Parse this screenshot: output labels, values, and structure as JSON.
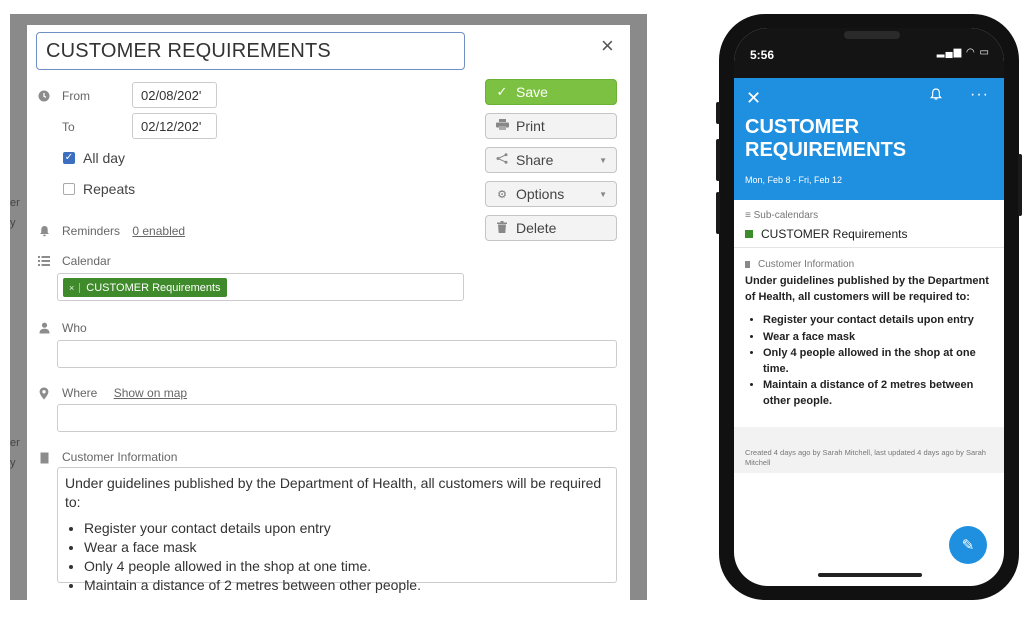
{
  "desktop": {
    "title": "CUSTOMER REQUIREMENTS",
    "close_glyph": "×",
    "from_label": "From",
    "from_value": "02/08/202'",
    "to_label": "To",
    "to_value": "02/12/202'",
    "all_day_label": "All day",
    "all_day_checked": true,
    "repeats_label": "Repeats",
    "reminders_label": "Reminders",
    "reminders_link": "0 enabled",
    "calendar_label": "Calendar",
    "calendar_tag_remove": "×",
    "calendar_tag": "CUSTOMER Requirements",
    "who_label": "Who",
    "where_label": "Where",
    "show_on_map": "Show on map",
    "customer_info_label": "Customer Information",
    "description_intro": "Under guidelines published by the Department of Health, all customers will be required to:",
    "description_items": [
      "Register your contact details upon entry",
      "Wear a face mask",
      "Only 4 people allowed in the shop at one time.",
      "Maintain a distance of 2 metres between other people."
    ],
    "buttons": {
      "save": "Save",
      "print": "Print",
      "share": "Share",
      "options": "Options",
      "delete": "Delete"
    },
    "colors": {
      "save": "#7cc142",
      "tag": "#3f8a2a",
      "title_border": "#6f8fc5"
    }
  },
  "mobile": {
    "time": "5:56",
    "title": "CUSTOMER REQUIREMENTS",
    "dates": "Mon, Feb 8 - Fri, Feb 12",
    "subcalendars_label": "Sub-calendars",
    "subcalendar_name": "CUSTOMER Requirements",
    "customer_info_label": "Customer Information",
    "intro": "Under guidelines published by the Department of Health, all customers will be required to:",
    "items": [
      "Register your contact details upon entry",
      "Wear a face mask",
      "Only 4 people allowed in the shop at one time.",
      "Maintain a distance of 2 metres between other people."
    ],
    "footer": "Created 4 days ago by Sarah Mitchell, last updated 4 days ago by Sarah Mitchell",
    "colors": {
      "header": "#1f8fe0"
    }
  }
}
